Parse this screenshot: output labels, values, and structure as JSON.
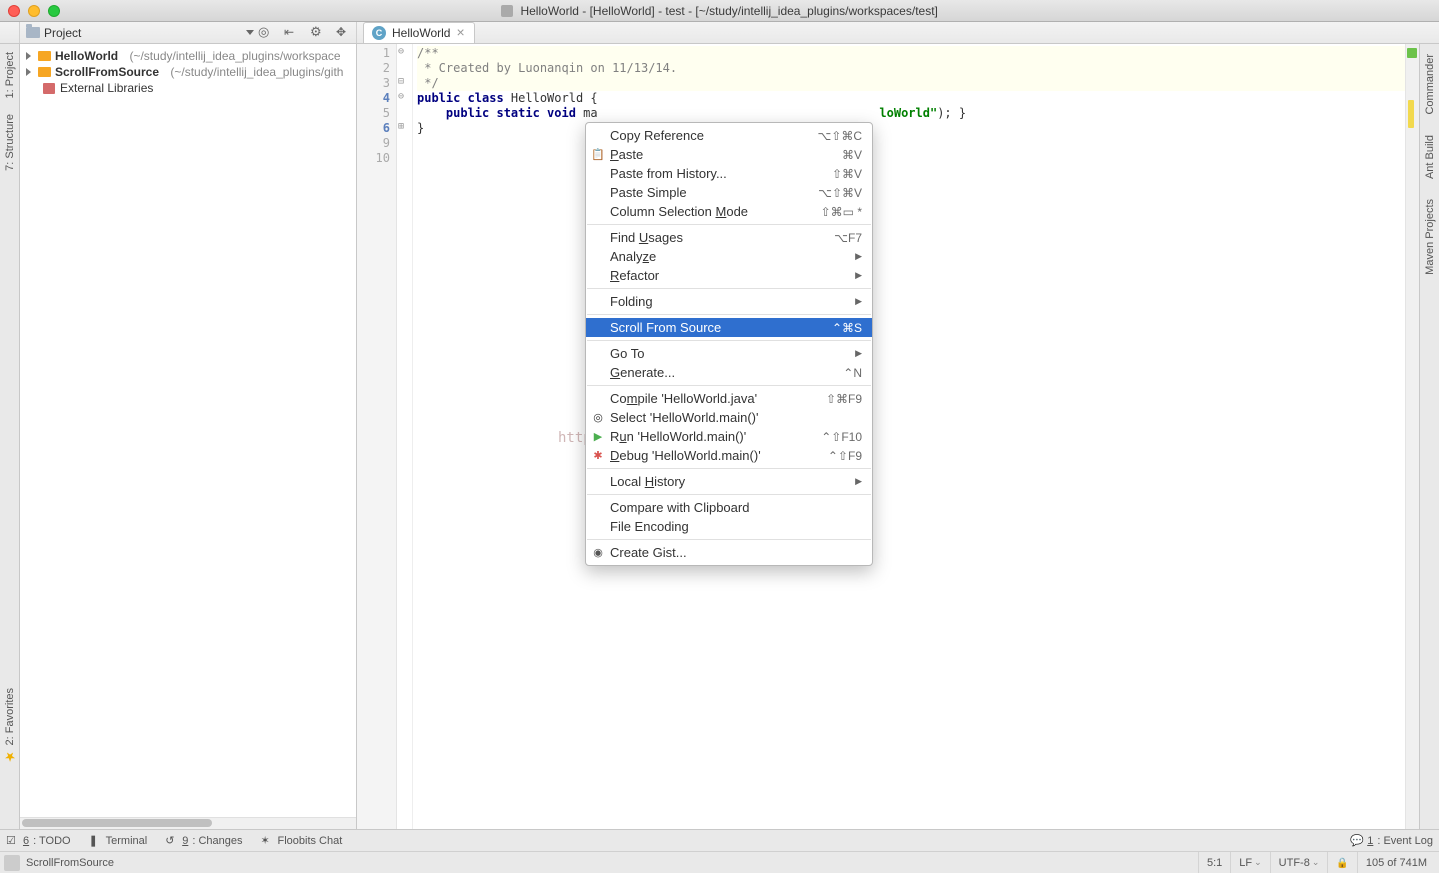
{
  "title": "HelloWorld - [HelloWorld] - test - [~/study/intellij_idea_plugins/workspaces/test]",
  "project_combo": "Project",
  "editor_tab": "HelloWorld",
  "tree": {
    "item0": {
      "name": "HelloWorld",
      "path": "(~/study/intellij_idea_plugins/workspace"
    },
    "item1": {
      "name": "ScrollFromSource",
      "path": "(~/study/intellij_idea_plugins/gith"
    },
    "item2": {
      "name": "External Libraries"
    }
  },
  "left_tabs": {
    "project": "1: Project",
    "structure": "7: Structure",
    "favorites": "2: Favorites"
  },
  "right_tabs": {
    "commander": "Commander",
    "ant": "Ant Build",
    "maven": "Maven Projects"
  },
  "gutter_lines": [
    "1",
    "2",
    "3",
    "4",
    "5",
    "6",
    "9",
    "10"
  ],
  "code": {
    "l1": "/**",
    "l2": " * Created by Luonanqin on 11/13/14.",
    "l3": " */",
    "l4_kw1": "public class",
    "l4_cls": " HelloWorld {",
    "l5": "",
    "l6_pre": "    ",
    "l6_kw": "public static void",
    "l6_mid": " ma",
    "l6_tail_str": "loWorld\"",
    "l6_tail_rest": "); } ",
    "l9": "}",
    "l10": ""
  },
  "menu": {
    "copy_ref": {
      "label": "Copy Reference",
      "short": "⌥⇧⌘C"
    },
    "paste": {
      "label": "Paste",
      "short": "⌘V"
    },
    "paste_hist": {
      "label": "Paste from History...",
      "short": "⇧⌘V"
    },
    "paste_simple": {
      "label": "Paste Simple",
      "short": "⌥⇧⌘V"
    },
    "col_sel": {
      "pre": "Column Selection ",
      "u": "M",
      "post": "ode",
      "short": "⇧⌘▭ *"
    },
    "find_usages": {
      "pre": "Find ",
      "u": "U",
      "post": "sages",
      "short": "⌥F7"
    },
    "analyze": {
      "pre": "Analy",
      "u": "z",
      "post": "e"
    },
    "refactor": {
      "pre": "",
      "u": "R",
      "post": "efactor"
    },
    "folding": {
      "label": "Folding"
    },
    "scroll_from_source": {
      "label": "Scroll From Source",
      "short": "⌃⌘S"
    },
    "go_to": {
      "label": "Go To"
    },
    "generate": {
      "pre": "",
      "u": "G",
      "post": "enerate...",
      "short": "⌃N"
    },
    "compile": {
      "pre": "Co",
      "u": "m",
      "post": "pile 'HelloWorld.java'",
      "short": "⇧⌘F9"
    },
    "select": {
      "label": "Select 'HelloWorld.main()'"
    },
    "run": {
      "pre": "R",
      "u": "u",
      "post": "n 'HelloWorld.main()'",
      "short": "⌃⇧F10"
    },
    "debug": {
      "pre": "",
      "u": "D",
      "post": "ebug 'HelloWorld.main()'",
      "short": "⌃⇧F9"
    },
    "local_hist": {
      "pre": "Local ",
      "u": "H",
      "post": "istory"
    },
    "compare_clip": {
      "label": "Compare with Clipboard"
    },
    "file_enc": {
      "label": "File Encoding"
    },
    "create_gist": {
      "label": "Create Gist..."
    }
  },
  "watermark": "http://         .com/luonanqin",
  "bottom": {
    "todo": "6: TODO",
    "terminal": "Terminal",
    "changes": "9: Changes",
    "floobits": "Floobits Chat",
    "event_log": "1: Event Log"
  },
  "status": {
    "breadcrumb": "ScrollFromSource",
    "cursor": "5:1",
    "line_sep": "LF",
    "encoding": "UTF-8",
    "mem": "105 of 741M"
  }
}
